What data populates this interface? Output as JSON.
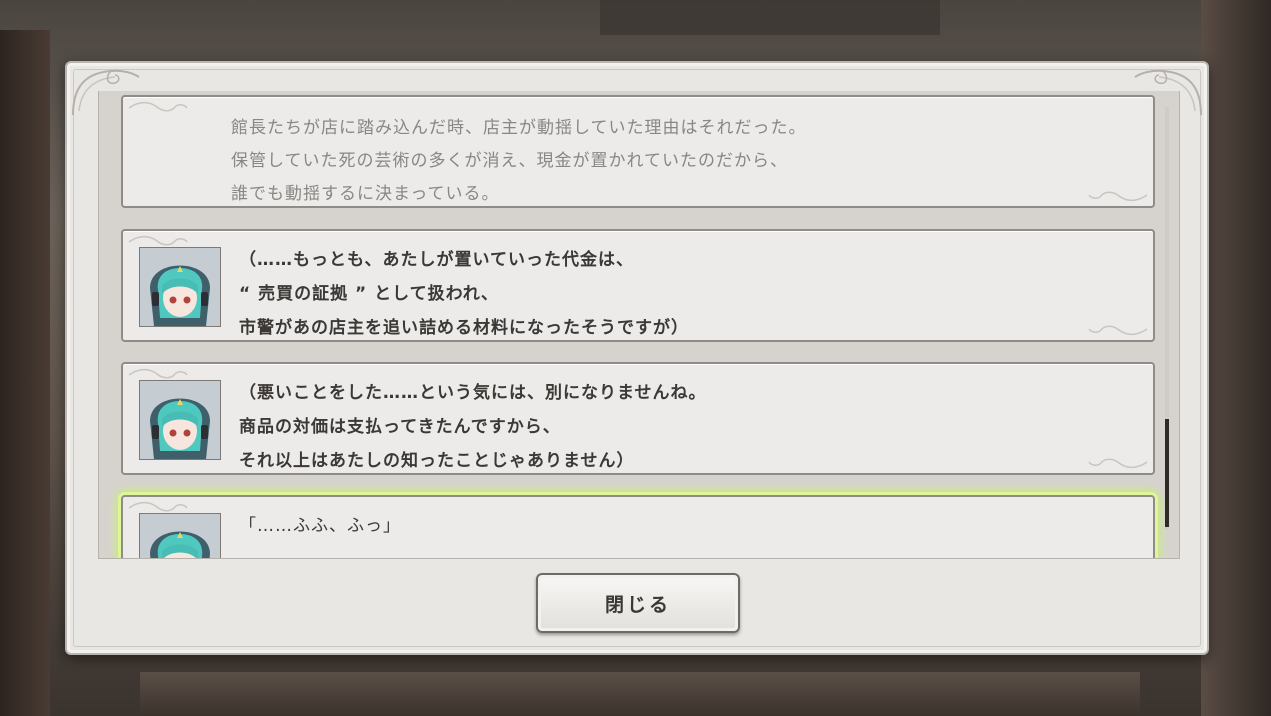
{
  "log": {
    "entries": [
      {
        "type": "narration",
        "lines": [
          "館長たちが店に踏み込んだ時、店主が動揺していた理由はそれだった。",
          "保管していた死の芸術の多くが消え、現金が置かれていたのだから、",
          "誰でも動揺するに決まっている。"
        ]
      },
      {
        "type": "speech",
        "portrait": "character-portrait",
        "lines": [
          "（……もっとも、あたしが置いていった代金は、",
          " “ 売買の証拠 ” として扱われ、",
          " 市警があの店主を追い詰める材料になったそうですが）"
        ]
      },
      {
        "type": "speech",
        "portrait": "character-portrait",
        "lines": [
          "（悪いことをした……という気には、別になりませんね。",
          " 商品の対価は支払ってきたんですから、",
          " それ以上はあたしの知ったことじゃありません）"
        ]
      },
      {
        "type": "speech",
        "portrait": "character-portrait",
        "highlighted": true,
        "lines": [
          "「……ふふ、ふっ」"
        ]
      }
    ]
  },
  "scroll": {
    "position_fraction": 0.74
  },
  "close_button": {
    "label": "閉じる"
  },
  "colors": {
    "highlight": "#c9f06a",
    "panel": "#e9e7e4",
    "entry_bg": "#ecebe9",
    "text_speech": "#3b3835",
    "text_narration": "#8a8683"
  }
}
